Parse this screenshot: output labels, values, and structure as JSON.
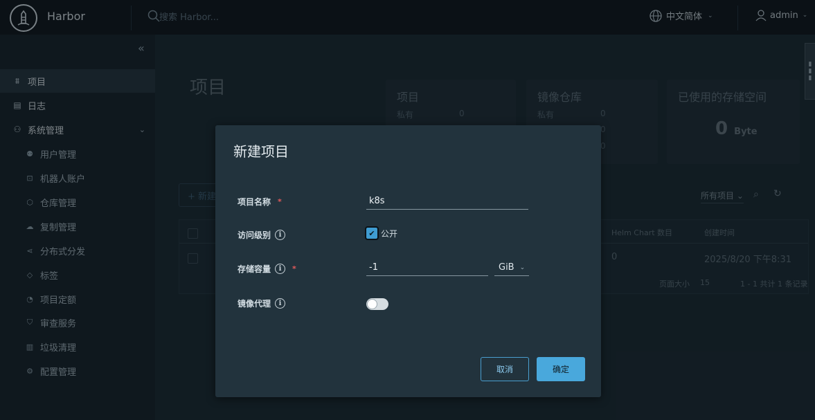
{
  "app": {
    "name": "Harbor"
  },
  "header": {
    "search_placeholder": "搜索 Harbor...",
    "language": "中文简体",
    "user": "admin"
  },
  "sidebar": {
    "items": [
      {
        "label": "项目",
        "icon": "projects-icon",
        "active": true
      },
      {
        "label": "日志",
        "icon": "logs-icon"
      },
      {
        "label": "系统管理",
        "icon": "admin-icon",
        "expanded": true
      }
    ],
    "sub_items": [
      {
        "label": "用户管理",
        "icon": "users-icon"
      },
      {
        "label": "机器人账户",
        "icon": "robot-icon"
      },
      {
        "label": "仓库管理",
        "icon": "registry-icon"
      },
      {
        "label": "复制管理",
        "icon": "replication-icon"
      },
      {
        "label": "分布式分发",
        "icon": "distribution-icon"
      },
      {
        "label": "标签",
        "icon": "tag-icon"
      },
      {
        "label": "项目定额",
        "icon": "quota-icon"
      },
      {
        "label": "审查服务",
        "icon": "shield-icon"
      },
      {
        "label": "垃圾清理",
        "icon": "trash-icon"
      },
      {
        "label": "配置管理",
        "icon": "gear-icon"
      }
    ]
  },
  "main": {
    "title": "项目",
    "cards": {
      "projects": {
        "title": "项目",
        "private_label": "私有",
        "private_value": "0"
      },
      "repos": {
        "title": "镜像仓库",
        "private_label": "私有",
        "private_value": "0",
        "val2": "0",
        "val3": "0"
      },
      "storage": {
        "title": "已使用的存储空间",
        "value": "0",
        "unit": "Byte"
      }
    },
    "new_button": "+ 新建",
    "filter": "所有项目",
    "table": {
      "headers": {
        "helm": "Helm Chart 数目",
        "created": "创建时间"
      },
      "row": {
        "helm": "0",
        "created": "2025/8/20 下午8:31"
      },
      "page_size_label": "页面大小",
      "page_size": "15",
      "summary": "1 - 1 共计 1 条记录"
    }
  },
  "modal": {
    "title": "新建项目",
    "fields": {
      "name": {
        "label": "项目名称",
        "value": "k8s"
      },
      "access": {
        "label": "访问级别",
        "checkbox_label": "公开",
        "checked": true
      },
      "quota": {
        "label": "存储容量",
        "value": "-1",
        "unit": "GiB"
      },
      "proxy": {
        "label": "镜像代理",
        "enabled": false
      }
    },
    "cancel": "取消",
    "confirm": "确定"
  },
  "colors": {
    "accent": "#49a8dc",
    "header_bg": "#0f171c",
    "sidebar_bg": "#17242b",
    "modal_bg": "#22333d"
  }
}
